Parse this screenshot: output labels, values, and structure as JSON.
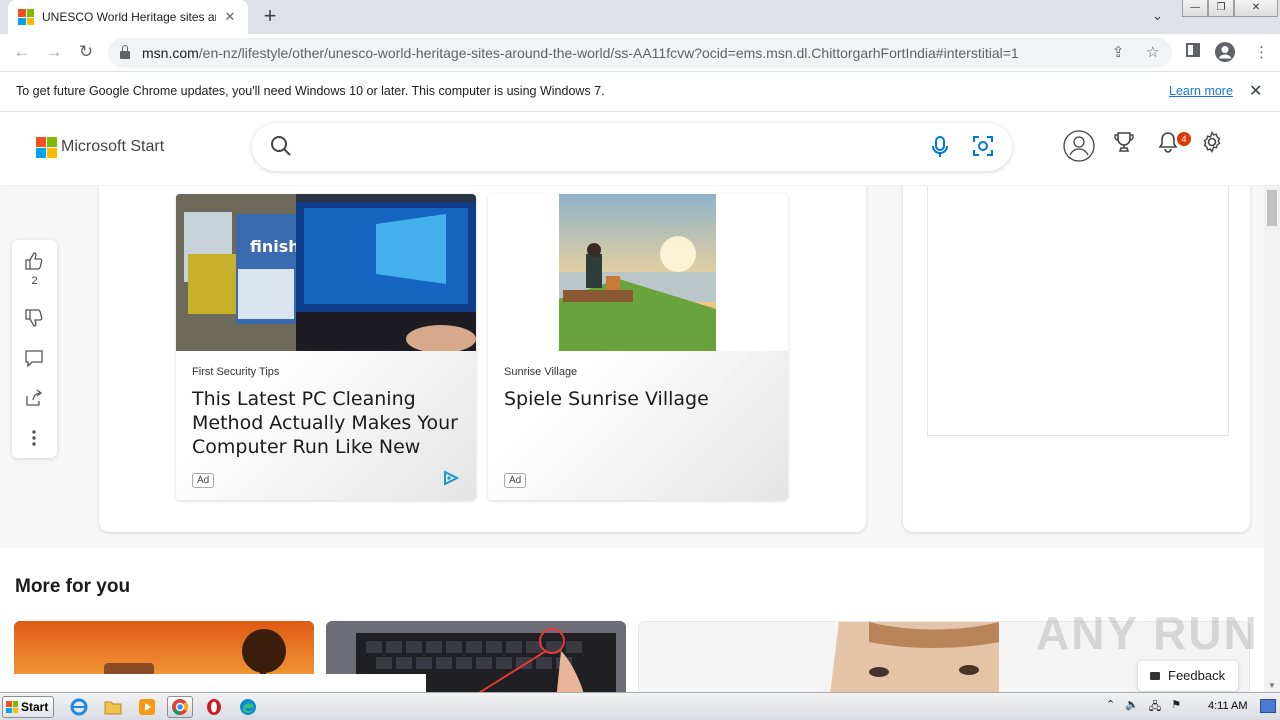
{
  "browser": {
    "tab_title": "UNESCO World Heritage sites around the world",
    "new_tab_symbol": "+",
    "url_host": "msn.com",
    "url_path": "/en-nz/lifestyle/other/unesco-world-heritage-sites-around-the-world/ss-AA11fcvw?ocid=ems.msn.dl.ChittorgarhFortIndia#interstitial=1",
    "window_controls": [
      "—",
      "❐",
      "✕"
    ]
  },
  "infobar": {
    "message": "To get future Google Chrome updates, you'll need Windows 10 or later. This computer is using Windows 7.",
    "learn_more": "Learn more"
  },
  "msn": {
    "brand": "Microsoft Start",
    "notification_count": "4",
    "colors": {
      "accent": "#0078d4",
      "badge": "#d83b01"
    }
  },
  "reactions": {
    "like_count": "2"
  },
  "ads": [
    {
      "source": "First Security Tips",
      "title": "This Latest PC Cleaning Method Actually Makes Your Computer Run Like New",
      "badge": "Ad"
    },
    {
      "source": "Sunrise Village",
      "title": "Spiele Sunrise Village",
      "badge": "Ad"
    }
  ],
  "more_for_you": {
    "title": "More for you"
  },
  "feedback": {
    "label": "Feedback"
  },
  "watermark": "ANY RUN",
  "taskbar": {
    "start_label": "Start",
    "clock": "4:11 AM"
  }
}
